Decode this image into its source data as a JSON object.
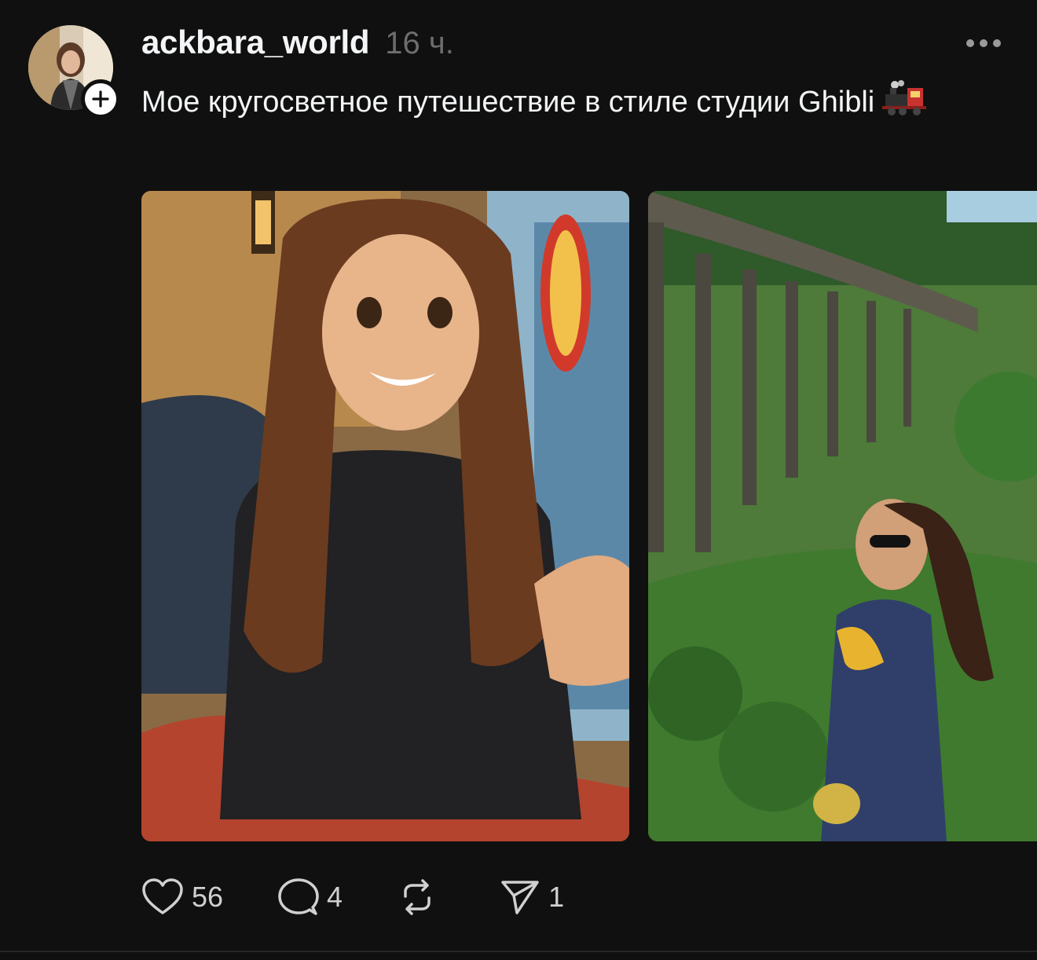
{
  "post": {
    "username": "ackbara_world",
    "time": "16 ч.",
    "caption": "Мое кругосветное путешествие в стиле студии Ghibli",
    "caption_emoji": "steam-locomotive-emoji"
  },
  "media": [
    {
      "description_name": "anime-selfie-image"
    },
    {
      "description_name": "anime-viaduct-jungle-image"
    }
  ],
  "actions": {
    "likes": "56",
    "replies": "4",
    "reposts": "",
    "shares": "1"
  },
  "colors": {
    "background": "#101010",
    "text": "#f3f5f7",
    "muted": "#6d6d6d"
  }
}
